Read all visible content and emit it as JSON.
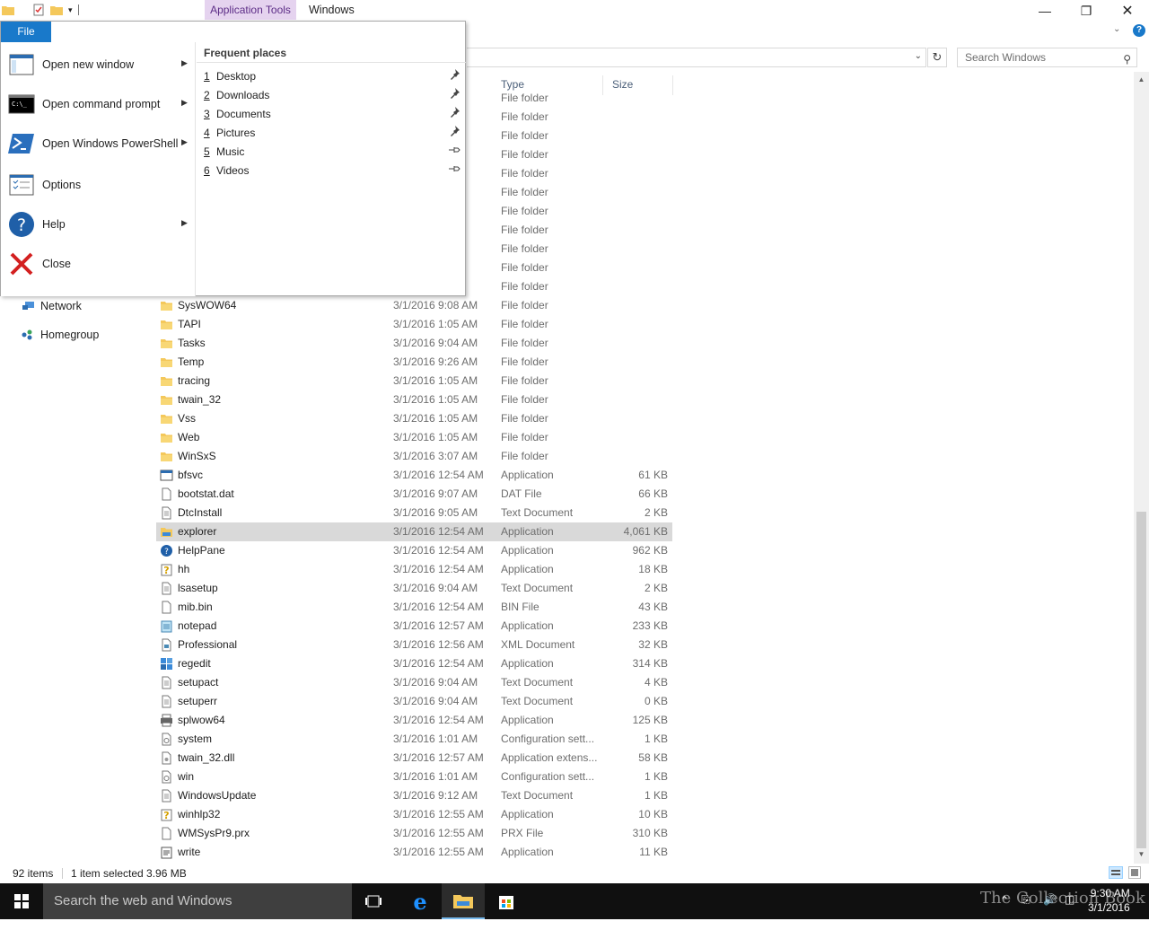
{
  "window": {
    "context_tab": "Application Tools",
    "title": "Windows",
    "search_placeholder": "Search Windows"
  },
  "columns": {
    "type": "Type",
    "size": "Size"
  },
  "nav": [
    {
      "label": "Network",
      "icon": "network-icon"
    },
    {
      "label": "Homegroup",
      "icon": "homegroup-icon"
    }
  ],
  "files": [
    {
      "name": "",
      "date": "",
      "type": "File folder",
      "size": "",
      "icon": "folder"
    },
    {
      "name": "",
      "date": "",
      "type": "File folder",
      "size": "",
      "icon": "folder"
    },
    {
      "name": "",
      "date": "",
      "type": "File folder",
      "size": "",
      "icon": "folder"
    },
    {
      "name": "",
      "date": "",
      "type": "File folder",
      "size": "",
      "icon": "folder"
    },
    {
      "name": "",
      "date": "",
      "type": "File folder",
      "size": "",
      "icon": "folder"
    },
    {
      "name": "",
      "date": "",
      "type": "File folder",
      "size": "",
      "icon": "folder"
    },
    {
      "name": "",
      "date": "",
      "type": "File folder",
      "size": "",
      "icon": "folder"
    },
    {
      "name": "",
      "date": "",
      "type": "File folder",
      "size": "",
      "icon": "folder"
    },
    {
      "name": "",
      "date": "",
      "type": "File folder",
      "size": "",
      "icon": "folder"
    },
    {
      "name": "",
      "date": "",
      "type": "File folder",
      "size": "",
      "icon": "folder"
    },
    {
      "name": "",
      "date": "",
      "type": "File folder",
      "size": "",
      "icon": "folder"
    },
    {
      "name": "SysWOW64",
      "date": "3/1/2016 9:08 AM",
      "type": "File folder",
      "size": "",
      "icon": "folder"
    },
    {
      "name": "TAPI",
      "date": "3/1/2016 1:05 AM",
      "type": "File folder",
      "size": "",
      "icon": "folder"
    },
    {
      "name": "Tasks",
      "date": "3/1/2016 9:04 AM",
      "type": "File folder",
      "size": "",
      "icon": "folder"
    },
    {
      "name": "Temp",
      "date": "3/1/2016 9:26 AM",
      "type": "File folder",
      "size": "",
      "icon": "folder"
    },
    {
      "name": "tracing",
      "date": "3/1/2016 1:05 AM",
      "type": "File folder",
      "size": "",
      "icon": "folder"
    },
    {
      "name": "twain_32",
      "date": "3/1/2016 1:05 AM",
      "type": "File folder",
      "size": "",
      "icon": "folder"
    },
    {
      "name": "Vss",
      "date": "3/1/2016 1:05 AM",
      "type": "File folder",
      "size": "",
      "icon": "folder"
    },
    {
      "name": "Web",
      "date": "3/1/2016 1:05 AM",
      "type": "File folder",
      "size": "",
      "icon": "folder"
    },
    {
      "name": "WinSxS",
      "date": "3/1/2016 3:07 AM",
      "type": "File folder",
      "size": "",
      "icon": "folder"
    },
    {
      "name": "bfsvc",
      "date": "3/1/2016 12:54 AM",
      "type": "Application",
      "size": "61 KB",
      "icon": "app"
    },
    {
      "name": "bootstat.dat",
      "date": "3/1/2016 9:07 AM",
      "type": "DAT File",
      "size": "66 KB",
      "icon": "file"
    },
    {
      "name": "DtcInstall",
      "date": "3/1/2016 9:05 AM",
      "type": "Text Document",
      "size": "2 KB",
      "icon": "text"
    },
    {
      "name": "explorer",
      "date": "3/1/2016 12:54 AM",
      "type": "Application",
      "size": "4,061 KB",
      "icon": "explorer",
      "selected": true
    },
    {
      "name": "HelpPane",
      "date": "3/1/2016 12:54 AM",
      "type": "Application",
      "size": "962 KB",
      "icon": "help"
    },
    {
      "name": "hh",
      "date": "3/1/2016 12:54 AM",
      "type": "Application",
      "size": "18 KB",
      "icon": "hh"
    },
    {
      "name": "lsasetup",
      "date": "3/1/2016 9:04 AM",
      "type": "Text Document",
      "size": "2 KB",
      "icon": "text"
    },
    {
      "name": "mib.bin",
      "date": "3/1/2016 12:54 AM",
      "type": "BIN File",
      "size": "43 KB",
      "icon": "file"
    },
    {
      "name": "notepad",
      "date": "3/1/2016 12:57 AM",
      "type": "Application",
      "size": "233 KB",
      "icon": "notepad"
    },
    {
      "name": "Professional",
      "date": "3/1/2016 12:56 AM",
      "type": "XML Document",
      "size": "32 KB",
      "icon": "xml"
    },
    {
      "name": "regedit",
      "date": "3/1/2016 12:54 AM",
      "type": "Application",
      "size": "314 KB",
      "icon": "regedit"
    },
    {
      "name": "setupact",
      "date": "3/1/2016 9:04 AM",
      "type": "Text Document",
      "size": "4 KB",
      "icon": "text"
    },
    {
      "name": "setuperr",
      "date": "3/1/2016 9:04 AM",
      "type": "Text Document",
      "size": "0 KB",
      "icon": "text"
    },
    {
      "name": "splwow64",
      "date": "3/1/2016 12:54 AM",
      "type": "Application",
      "size": "125 KB",
      "icon": "printer"
    },
    {
      "name": "system",
      "date": "3/1/2016 1:01 AM",
      "type": "Configuration sett...",
      "size": "1 KB",
      "icon": "config"
    },
    {
      "name": "twain_32.dll",
      "date": "3/1/2016 12:57 AM",
      "type": "Application extens...",
      "size": "58 KB",
      "icon": "dll"
    },
    {
      "name": "win",
      "date": "3/1/2016 1:01 AM",
      "type": "Configuration sett...",
      "size": "1 KB",
      "icon": "config"
    },
    {
      "name": "WindowsUpdate",
      "date": "3/1/2016 9:12 AM",
      "type": "Text Document",
      "size": "1 KB",
      "icon": "text"
    },
    {
      "name": "winhlp32",
      "date": "3/1/2016 12:55 AM",
      "type": "Application",
      "size": "10 KB",
      "icon": "hh"
    },
    {
      "name": "WMSysPr9.prx",
      "date": "3/1/2016 12:55 AM",
      "type": "PRX File",
      "size": "310 KB",
      "icon": "file"
    },
    {
      "name": "write",
      "date": "3/1/2016 12:55 AM",
      "type": "Application",
      "size": "11 KB",
      "icon": "write"
    }
  ],
  "status": {
    "count": "92 items",
    "selection": "1 item selected  3.96 MB"
  },
  "file_menu": {
    "tab_label": "File",
    "items": [
      {
        "label": "Open new window",
        "icon": "new-window-icon",
        "submenu": true
      },
      {
        "label": "Open command prompt",
        "icon": "command-prompt-icon",
        "submenu": true
      },
      {
        "label": "Open Windows PowerShell",
        "icon": "powershell-icon",
        "submenu": true
      },
      {
        "label": "Options",
        "icon": "options-icon",
        "submenu": false
      },
      {
        "label": "Help",
        "icon": "help-icon",
        "submenu": true
      },
      {
        "label": "Close",
        "icon": "close-x-icon",
        "submenu": false
      }
    ],
    "frequent_title": "Frequent places",
    "frequent": [
      {
        "num": "1",
        "label": "Desktop",
        "pinned": true
      },
      {
        "num": "2",
        "label": "Downloads",
        "pinned": true
      },
      {
        "num": "3",
        "label": "Documents",
        "pinned": true
      },
      {
        "num": "4",
        "label": "Pictures",
        "pinned": true
      },
      {
        "num": "5",
        "label": "Music",
        "pinned": false
      },
      {
        "num": "6",
        "label": "Videos",
        "pinned": false
      }
    ]
  },
  "taskbar": {
    "search_placeholder": "Search the web and Windows",
    "time": "9:30 AM",
    "date": "3/1/2016",
    "watermark": "The Collection Book"
  },
  "colors": {
    "accent": "#1979ca",
    "context_tab_bg": "#e5d3ef",
    "selection": "#d9d9d9",
    "taskbar": "#101010"
  }
}
